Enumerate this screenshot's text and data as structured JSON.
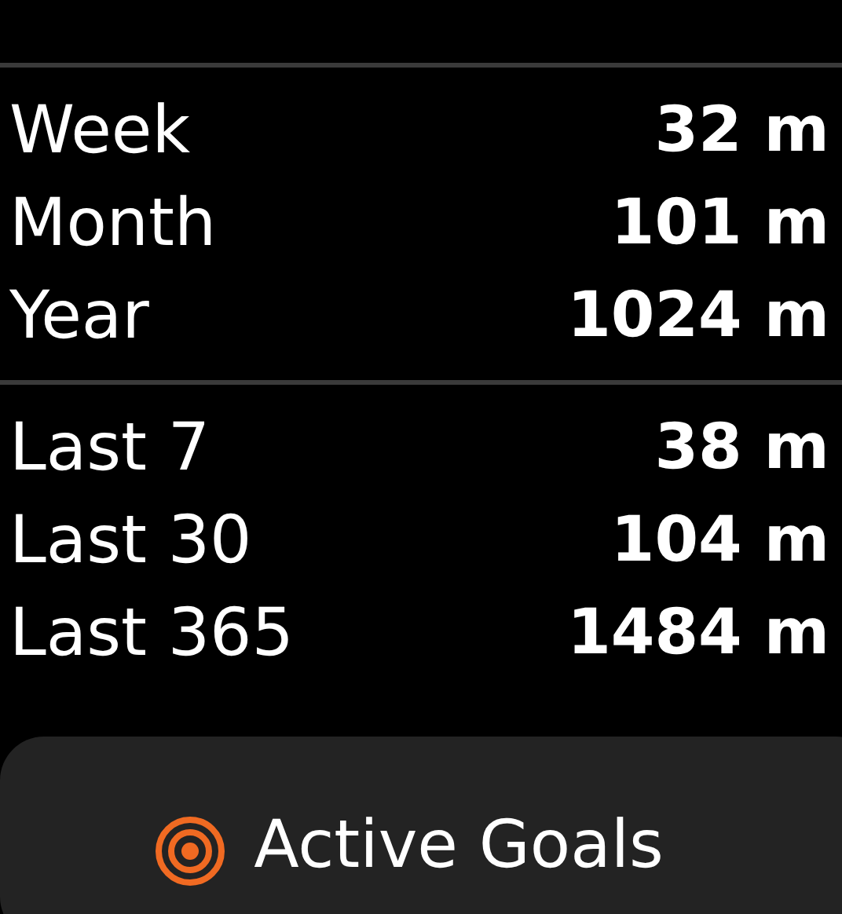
{
  "sections": [
    {
      "rows": [
        {
          "label": "Week",
          "value": "32 m"
        },
        {
          "label": "Month",
          "value": "101 m"
        },
        {
          "label": "Year",
          "value": "1024 m"
        }
      ]
    },
    {
      "rows": [
        {
          "label": "Last 7",
          "value": "38 m"
        },
        {
          "label": "Last 30",
          "value": "104 m"
        },
        {
          "label": "Last 365",
          "value": "1484 m"
        }
      ]
    }
  ],
  "button": {
    "label": "Active Goals"
  }
}
